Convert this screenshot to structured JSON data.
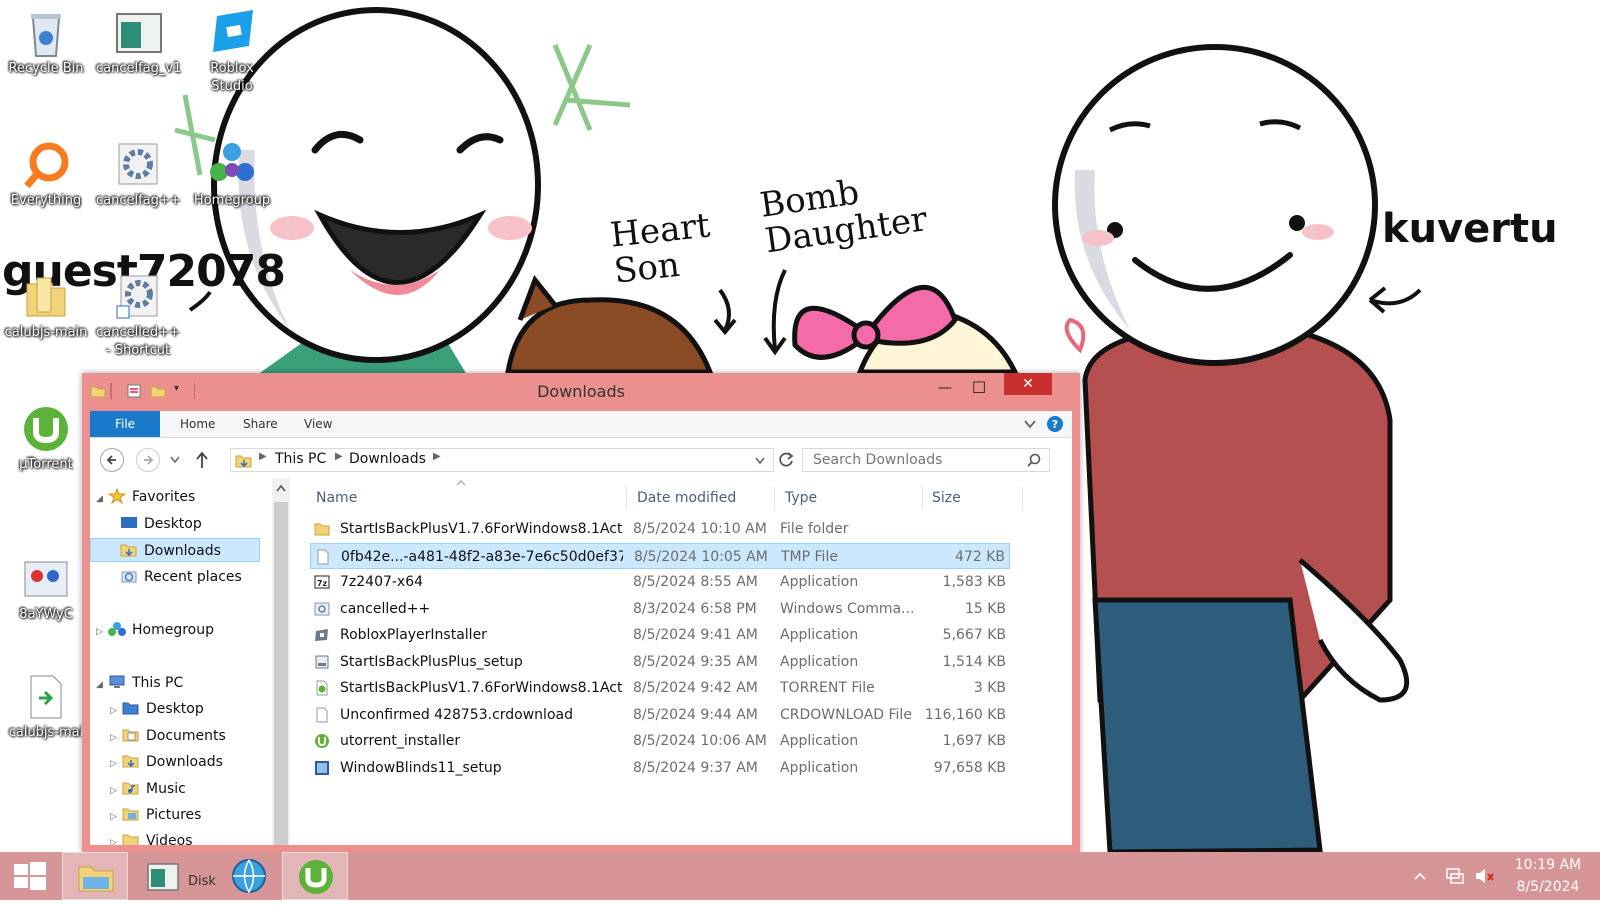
{
  "desktop": {
    "icons": [
      {
        "label": "Recycle Bin"
      },
      {
        "label": "cancelfag_v1"
      },
      {
        "label": "Roblox Studio"
      },
      {
        "label": "Everything"
      },
      {
        "label": "cancelfag++"
      },
      {
        "label": "Homegroup"
      },
      {
        "label": "calubjs-main"
      },
      {
        "label": "cancelled++ - Shortcut"
      },
      {
        "label": "µTorrent"
      },
      {
        "label": "8aYWyC"
      },
      {
        "label": "calubjs-mai"
      }
    ],
    "wallpaper_text": {
      "user": "guest72078",
      "heart_son": "Heart Son",
      "bomb_daughter": "Bomb Daughter",
      "name": "kuvertu"
    }
  },
  "window": {
    "title": "Downloads",
    "controls": {
      "minimize": "—",
      "maximize": "☐",
      "close": "✕"
    },
    "ribbon_tabs": [
      "File",
      "Home",
      "Share",
      "View"
    ],
    "address": {
      "root": "This PC",
      "folder": "Downloads"
    },
    "search_placeholder": "Search Downloads",
    "nav_pane": {
      "favorites": "Favorites",
      "favorites_items": [
        "Desktop",
        "Downloads",
        "Recent places"
      ],
      "homegroup": "Homegroup",
      "this_pc": "This PC",
      "this_pc_items": [
        "Desktop",
        "Documents",
        "Downloads",
        "Music",
        "Pictures",
        "Videos"
      ]
    },
    "columns": {
      "name": "Name",
      "date": "Date modified",
      "type": "Type",
      "size": "Size"
    },
    "files": [
      {
        "name": "StartIsBackPlusV1.7.6ForWindows8.1Activ...",
        "date": "8/5/2024 10:10 AM",
        "type": "File folder",
        "size": "",
        "icon": "folder-icon"
      },
      {
        "name": "0fb42e...-a481-48f2-a83e-7e6c50d0ef37...",
        "date": "8/5/2024 10:05 AM",
        "type": "TMP File",
        "size": "472 KB",
        "icon": "file-icon"
      },
      {
        "name": "7z2407-x64",
        "date": "8/5/2024 8:55 AM",
        "type": "Application",
        "size": "1,583 KB",
        "icon": "7zip-icon"
      },
      {
        "name": "cancelled++",
        "date": "8/3/2024 6:58 PM",
        "type": "Windows Comma...",
        "size": "15 KB",
        "icon": "cmd-icon"
      },
      {
        "name": "RobloxPlayerInstaller",
        "date": "8/5/2024 9:41 AM",
        "type": "Application",
        "size": "5,667 KB",
        "icon": "roblox-icon"
      },
      {
        "name": "StartIsBackPlusPlus_setup",
        "date": "8/5/2024 9:35 AM",
        "type": "Application",
        "size": "1,514 KB",
        "icon": "installer-icon"
      },
      {
        "name": "StartIsBackPlusV1.7.6ForWindows8.1Activ...",
        "date": "8/5/2024 9:42 AM",
        "type": "TORRENT File",
        "size": "3 KB",
        "icon": "torrent-file-icon"
      },
      {
        "name": "Unconfirmed 428753.crdownload",
        "date": "8/5/2024 9:44 AM",
        "type": "CRDOWNLOAD File",
        "size": "116,160 KB",
        "icon": "file-icon"
      },
      {
        "name": "utorrent_installer",
        "date": "8/5/2024 10:06 AM",
        "type": "Application",
        "size": "1,697 KB",
        "icon": "utorrent-icon"
      },
      {
        "name": "WindowBlinds11_setup",
        "date": "8/5/2024 9:37 AM",
        "type": "Application",
        "size": "97,658 KB",
        "icon": "windowblinds-icon"
      }
    ]
  },
  "taskbar": {
    "time": "10:19 AM",
    "date": "8/5/2024",
    "disk_label": "Disk"
  },
  "colors": {
    "window_frame": "#eb8f8f",
    "taskbar": "#d69597",
    "file_tab": "#1979ca",
    "selection": "#cce8ff"
  }
}
